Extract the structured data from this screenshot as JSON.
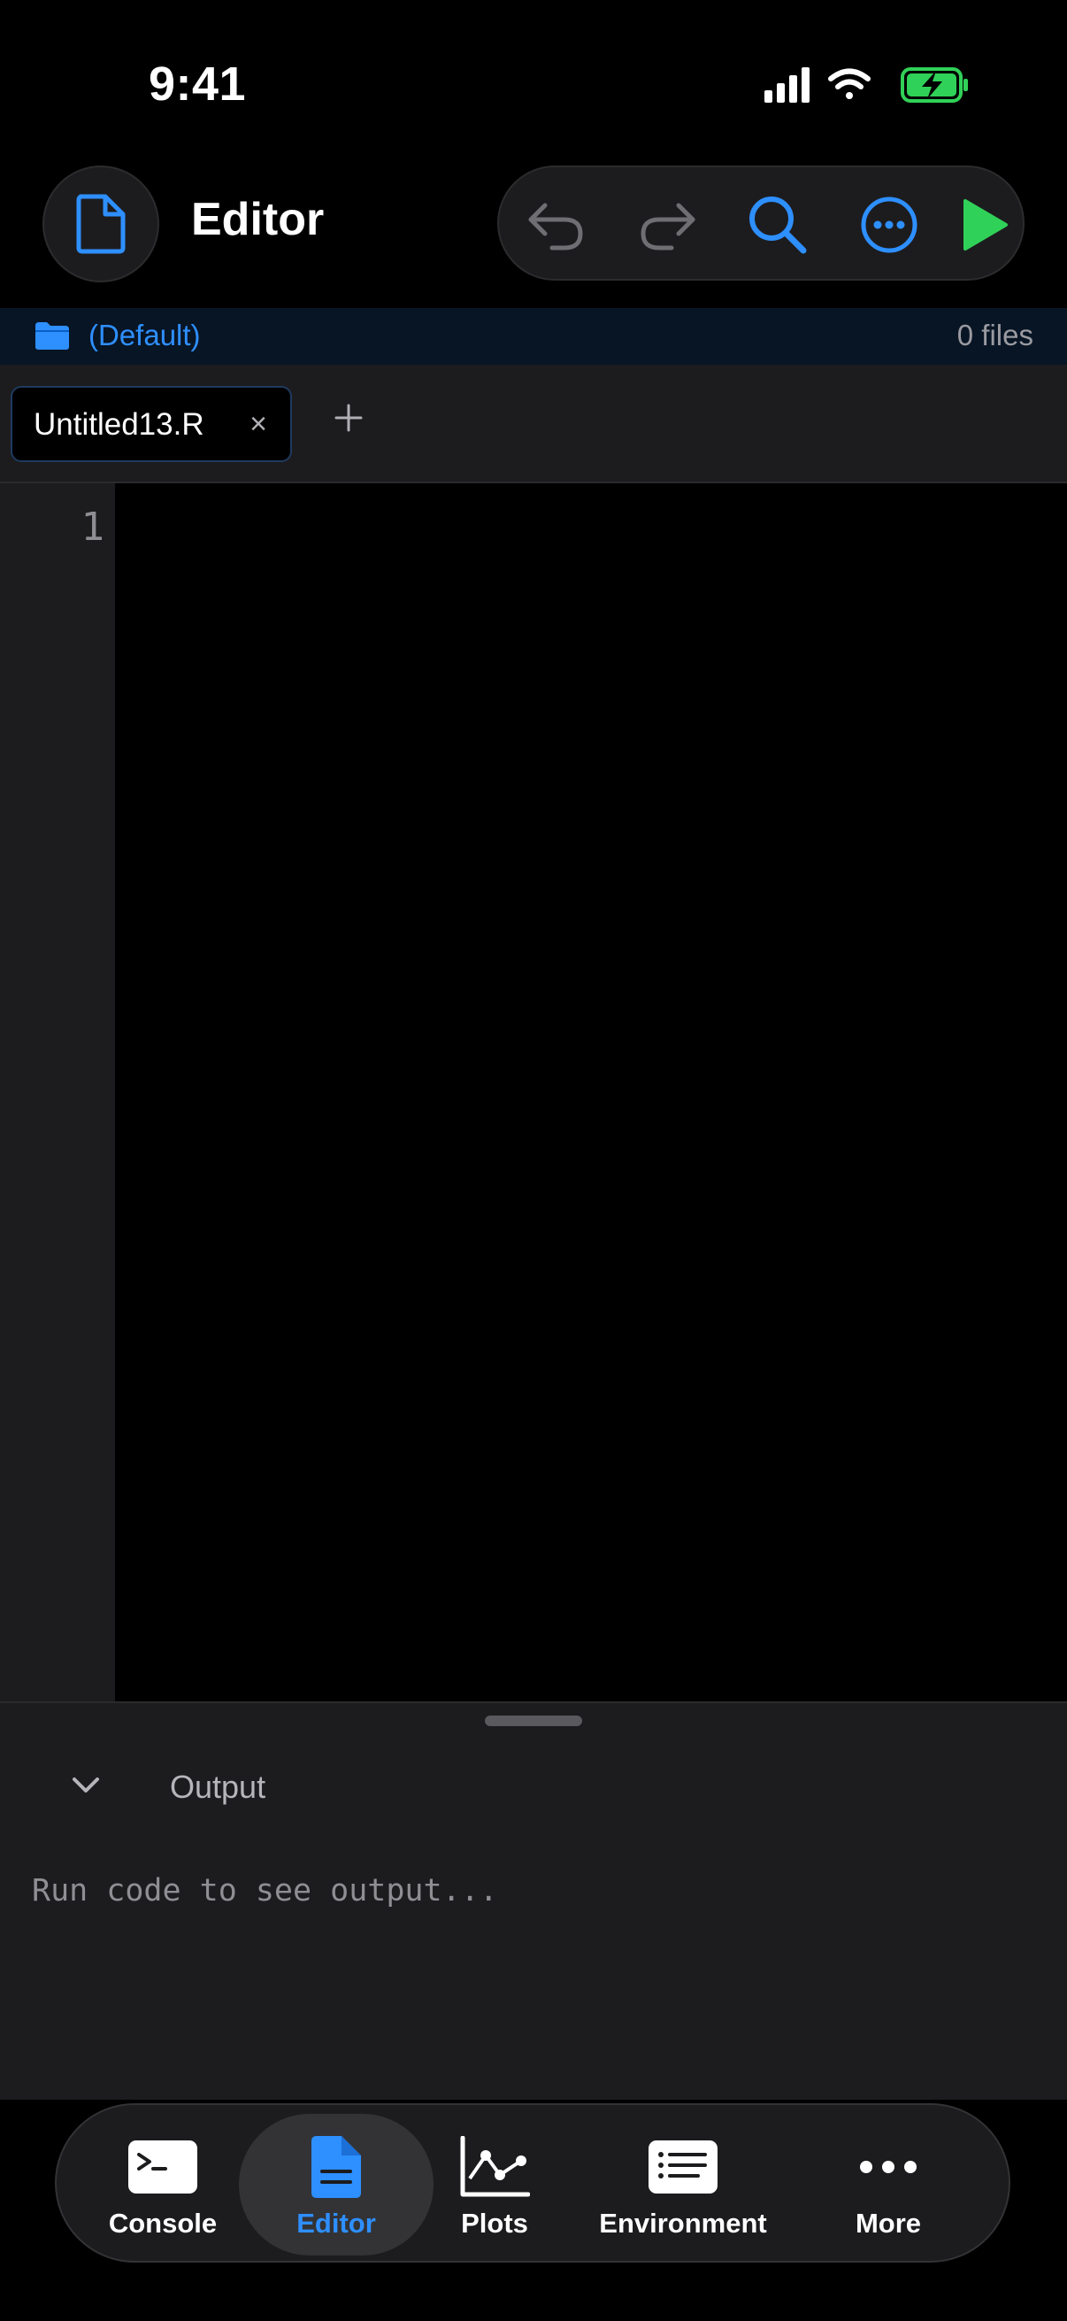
{
  "status": {
    "time": "9:41"
  },
  "header": {
    "title": "Editor"
  },
  "project": {
    "name": "(Default)",
    "file_count": "0 files"
  },
  "tabs": [
    {
      "label": "Untitled13.R",
      "close": "×"
    }
  ],
  "editor": {
    "line_numbers": [
      "1"
    ]
  },
  "output": {
    "label": "Output",
    "placeholder": "Run code to see output..."
  },
  "bottom_nav": [
    {
      "label": "Console",
      "icon": "terminal-icon"
    },
    {
      "label": "Editor",
      "icon": "document-icon",
      "active": true
    },
    {
      "label": "Plots",
      "icon": "line-chart-icon"
    },
    {
      "label": "Environment",
      "icon": "list-icon"
    },
    {
      "label": "More",
      "icon": "ellipsis-icon"
    }
  ],
  "colors": {
    "accent": "#2e8fff",
    "run": "#30d158",
    "background": "#000000",
    "panel": "#1c1c1e",
    "battery": "#30d158"
  }
}
